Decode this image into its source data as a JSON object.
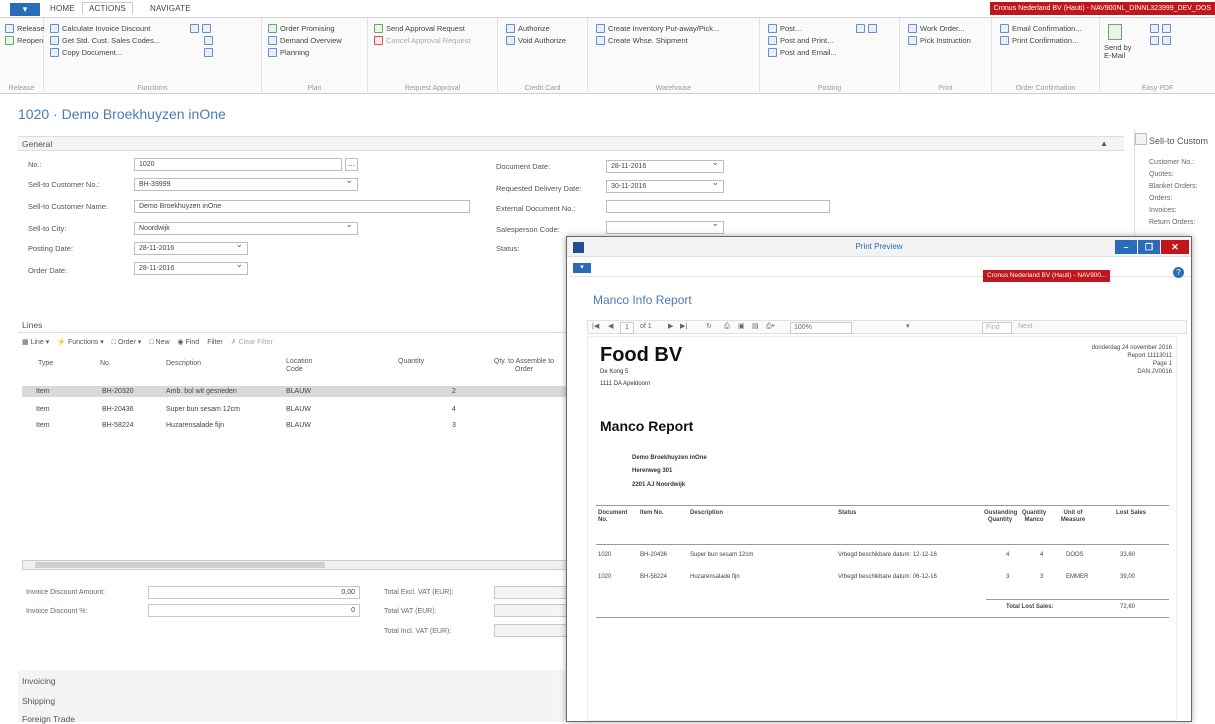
{
  "ribbon": {
    "app_button": "▾",
    "tabs": [
      "HOME",
      "ACTIONS",
      "NAVIGATE"
    ],
    "company": "Cronus Nederland BV (Hauti) - NAV900NL_DINNL323999_DEV_DOS",
    "groups": [
      {
        "label": "Release",
        "commands": [
          "Release",
          "Reopen"
        ]
      },
      {
        "label": "Functions",
        "commands": [
          "Calculate Invoice Discount",
          "Get Std. Cust. Sales Codes...",
          "Copy Document..."
        ]
      },
      {
        "label": "Plan",
        "commands": [
          "Order Promising",
          "Demand Overview",
          "Planning"
        ]
      },
      {
        "label": "Request Approval",
        "commands": [
          "Send Approval Request",
          "Cancel Approval Request"
        ]
      },
      {
        "label": "Credit Card",
        "commands": [
          "Authorize",
          "Void Authorize"
        ]
      },
      {
        "label": "Warehouse",
        "commands": [
          "Create Inventory Put-away/Pick...",
          "Create Whse. Shipment"
        ]
      },
      {
        "label": "Posting",
        "commands": [
          "Post...",
          "Post and Print...",
          "Post and Email..."
        ]
      },
      {
        "label": "Print",
        "commands": [
          "Work Order...",
          "Pick Instruction"
        ]
      },
      {
        "label": "Order Confirmation",
        "commands": [
          "Email Confirmation...",
          "Print Confirmation..."
        ]
      },
      {
        "label": "Easy PDF",
        "commands": [
          "Send by E-Mail"
        ]
      }
    ]
  },
  "page": {
    "title": "1020 · Demo Broekhuyzen inOne",
    "general_label": "General",
    "fields_left": [
      {
        "label": "No.:",
        "value": "1020"
      },
      {
        "label": "Sell-to Customer No.:",
        "value": "BH-39999"
      },
      {
        "label": "Sell-to Customer Name:",
        "value": "Demo Broekhuyzen inOne"
      },
      {
        "label": "Sell-to City:",
        "value": "Noordwijk"
      },
      {
        "label": "Posting Date:",
        "value": "28-11-2016"
      },
      {
        "label": "Order Date:",
        "value": "28-11-2016"
      }
    ],
    "fields_right": [
      {
        "label": "Document Date:",
        "value": "28-11-2016"
      },
      {
        "label": "Requested Delivery Date:",
        "value": "30-11-2016"
      },
      {
        "label": "External Document No.:",
        "value": ""
      },
      {
        "label": "Salesperson Code:",
        "value": ""
      },
      {
        "label": "Status:",
        "value": ""
      }
    ],
    "lines_label": "Lines",
    "lines_toolbar": [
      "Line ▾",
      "Functions ▾",
      "Order ▾",
      "New",
      "Find",
      "Filter",
      "Clear Filter"
    ],
    "columns": [
      "Type",
      "No.",
      "Description",
      "Location Code",
      "Quantity",
      "Qty. to Assemble to Order"
    ],
    "rows": [
      [
        "Item",
        "BH-20320",
        "Amb. bol wit gesneden",
        "BLAUW",
        "2"
      ],
      [
        "Item",
        "BH-20436",
        "Super bun sesam 12cm",
        "BLAUW",
        "4"
      ],
      [
        "Item",
        "BH-58224",
        "Huzarensalade fijn",
        "BLAUW",
        "3"
      ]
    ],
    "totals_left": [
      {
        "label": "Invoice Discount Amount:",
        "value": "0,00"
      },
      {
        "label": "Invoice Discount %:",
        "value": "0"
      }
    ],
    "totals_right": [
      "Total Excl. VAT (EUR):",
      "Total VAT (EUR):",
      "Total Incl. VAT (EUR):"
    ],
    "fasttabs": [
      "Invoicing",
      "Shipping",
      "Foreign Trade"
    ]
  },
  "side_panel": {
    "title": "Sell-to Custom",
    "items": [
      "Customer No.:",
      "Quotes:",
      "Blanket Orders:",
      "Orders:",
      "Invoices:",
      "Return Orders:"
    ]
  },
  "print_preview": {
    "window_title": "Print Preview",
    "company": "Cronus Nederland BV (Hauti) - NAV900...",
    "report_title": "Manco Info Report",
    "page_of": "of 1",
    "page_current": "1",
    "zoom": "100%",
    "find": "Find",
    "next": "Next",
    "report": {
      "company_name": "Food BV",
      "address1": "De Kong 5",
      "address2": "1111 DA Apeldoorn",
      "date": "donderdag 24 november 2016",
      "report_id": "Report 11113011",
      "page": "Page 1",
      "user": "DAN.JV0016",
      "heading": "Manco Report",
      "customer_name": "Demo Broekhuyzen inOne",
      "customer_street": "Herenweg 301",
      "customer_city": "2201 AJ Noordwijk",
      "columns": [
        "Document No.",
        "Item No.",
        "Description",
        "Status",
        "Oustanding Quantity",
        "Quantity Manco",
        "Unit of Measure",
        "Lost Sales"
      ],
      "rows": [
        [
          "1020",
          "BH-20436",
          "Super bun sesam 12cm",
          "Vrbegd beschikbare datum: 12-12-16",
          "4",
          "4",
          "DOOS",
          "33,60"
        ],
        [
          "1020",
          "BH-58224",
          "Huzarensalade fijn",
          "Vrbegd beschikbare datum: 06-12-16",
          "3",
          "3",
          "EMMER",
          "39,00"
        ]
      ],
      "total_label": "Total Lost Sales:",
      "total_value": "72,60"
    }
  }
}
